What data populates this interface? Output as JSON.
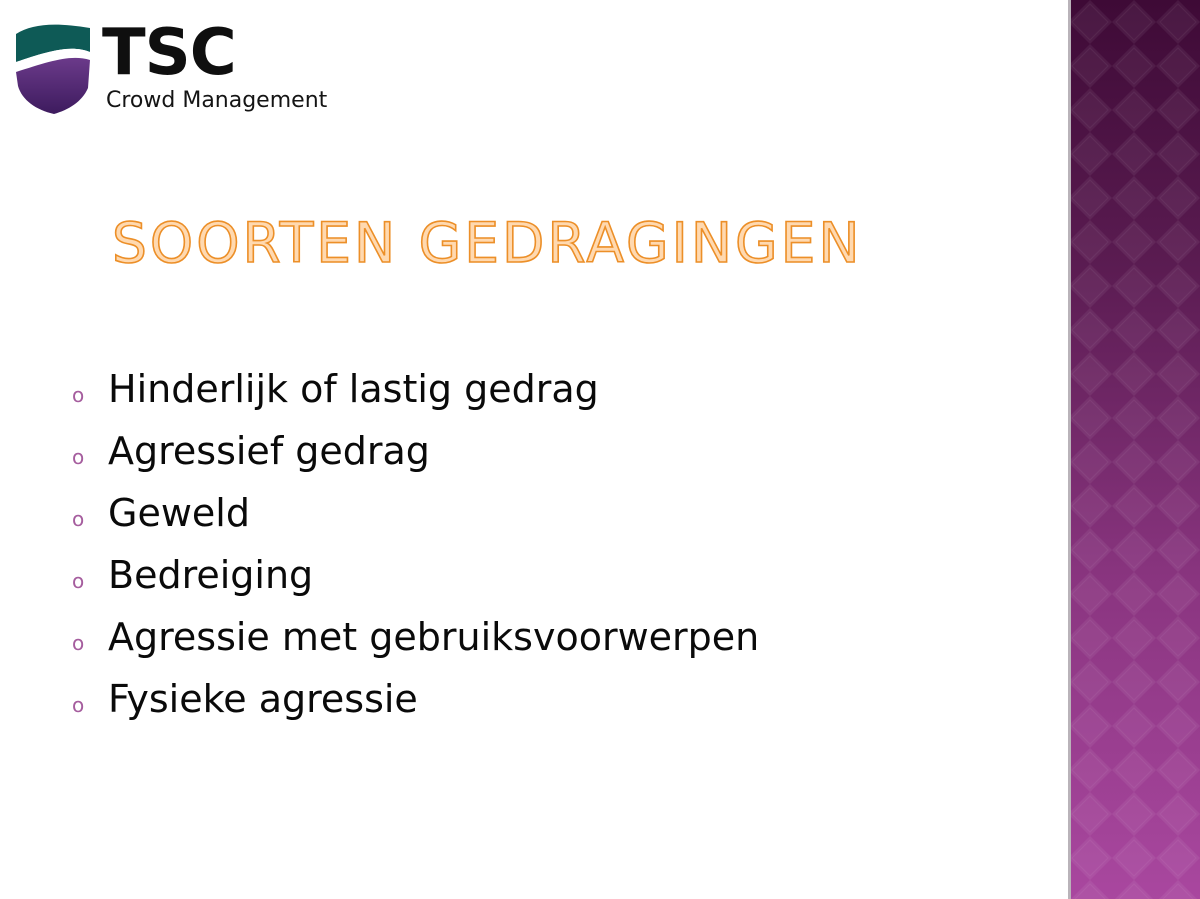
{
  "logo": {
    "brand": "TSC",
    "subtitle": "Crowd Management",
    "icon": "shield-wave-icon"
  },
  "title": "SOORTEN GEDRAGINGEN",
  "bullet_marker": "o",
  "bullets": [
    "Hinderlijk of lastig gedrag",
    "Agressief gedrag",
    "Geweld",
    "Bedreiging",
    "Agressie met gebruiksvoorwerpen",
    "Fysieke agressie"
  ],
  "colors": {
    "title_fill": "#ffd9b0",
    "title_outline": "#ec8f28",
    "bullet_marker": "#a55d9e",
    "band_top": "#3e0a36",
    "band_bottom": "#a9479f",
    "logo_teal": "#0e5a56",
    "logo_purple": "#5a2a78"
  }
}
